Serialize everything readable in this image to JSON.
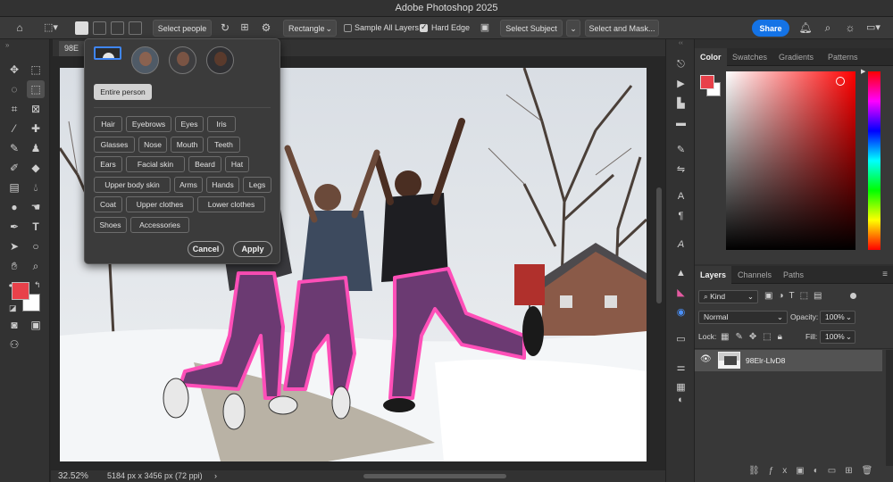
{
  "app": {
    "title": "Adobe Photoshop 2025"
  },
  "options_bar": {
    "select_people_label": "Select people",
    "shape_select_value": "Rectangle",
    "sample_all_layers_label": "Sample All Layers",
    "sample_all_layers_checked": false,
    "hard_edge_label": "Hard Edge",
    "hard_edge_checked": true,
    "select_subject_label": "Select Subject",
    "select_and_mask_label": "Select and Mask...",
    "share_label": "Share",
    "share_color": "#1473e6"
  },
  "document": {
    "tab_label": "98E",
    "zoom": "32.52%",
    "info": "5184 px x 3456 px (72 ppi)"
  },
  "popup": {
    "entire_person_label": "Entire person",
    "parts": [
      [
        "Hair",
        "Eyebrows",
        "Eyes",
        "Iris"
      ],
      [
        "Glasses",
        "Nose",
        "Mouth",
        "Teeth"
      ],
      [
        "Ears",
        "Facial skin",
        "Beard",
        "Hat"
      ],
      [
        "Upper body skin",
        "Arms",
        "Hands",
        "Legs"
      ],
      [
        "Coat",
        "Upper clothes",
        "Lower clothes"
      ],
      [
        "Shoes",
        "Accessories"
      ]
    ],
    "cancel_label": "Cancel",
    "apply_label": "Apply"
  },
  "color_panel": {
    "tabs": [
      "Color",
      "Swatches",
      "Gradients",
      "Patterns"
    ],
    "active_tab": "Color",
    "foreground": "#e8414a",
    "background": "#ffffff"
  },
  "layers_panel": {
    "tabs": [
      "Layers",
      "Channels",
      "Paths"
    ],
    "active_tab": "Layers",
    "filter_kind": "Kind",
    "blend_mode": "Normal",
    "opacity_label": "Opacity:",
    "opacity_value": "100%",
    "lock_label": "Lock:",
    "fill_label": "Fill:",
    "fill_value": "100%",
    "layers": [
      {
        "name": "98Elr-LlvD8",
        "visible": true
      }
    ]
  }
}
